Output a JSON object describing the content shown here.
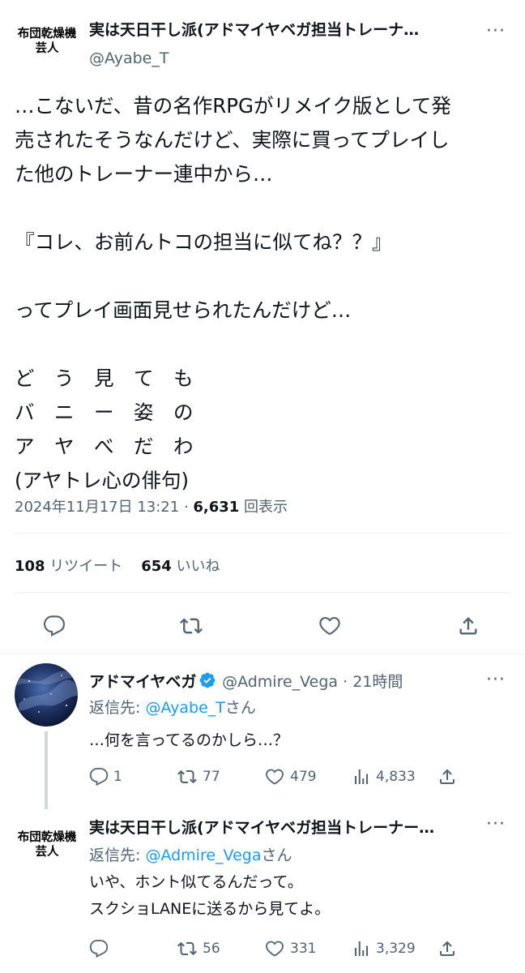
{
  "main_tweet": {
    "avatar_text_line1": "布団乾燥機",
    "avatar_text_line2": "芸人",
    "display_name": "実は天日干し派(アドマイヤベガ担当トレーナ…",
    "handle": "@Ayabe_T",
    "more_label": "···",
    "body_lines": [
      "…こないだ、昔の名作RPGがリメイク版として発",
      "売されたそうなんだけど、実際に買ってプレイし",
      "た他のトレーナー連中から…",
      "",
      "『コレ、お前んトコの担当に似てね？？』",
      "",
      "ってプレイ画面見せられたんだけど…",
      "",
      "ど　う　見　て　も",
      "バ　ニ　ー　姿　の",
      "ア　ヤ　べ　だ　わ",
      "(アヤトレ心の俳句)"
    ],
    "timestamp": "2024年11月17日 13:21",
    "separator": " · ",
    "views_count": "6,631",
    "views_label": " 回表示",
    "retweets_count": "108",
    "retweets_label": " リツイート",
    "likes_count": "654",
    "likes_label": " いいね",
    "actions": [
      "reply-icon",
      "retweet-icon",
      "like-icon",
      "share-icon"
    ]
  },
  "replies": [
    {
      "display_name": "アドマイヤベガ",
      "handle_time": "@Admire_Vega · 21時間",
      "more_label": "···",
      "reply_to_prefix": "返信先: ",
      "reply_to_mention": "@Ayabe_T",
      "reply_to_suffix": "さん",
      "text_lines": [
        "…何を言ってるのかしら…？"
      ],
      "reply_count": "1",
      "retweet_count": "77",
      "like_count": "479",
      "views_count": "4,833",
      "verified": true,
      "avatar_colors": [
        "#0b1a3a",
        "#3f5f9a"
      ]
    },
    {
      "avatar_text_line1": "布団乾燥機",
      "avatar_text_line2": "芸人",
      "display_name": "実は天日干し派(アドマイヤベガ担当トレーナー…",
      "more_label": "···",
      "reply_to_prefix": "返信先: ",
      "reply_to_mention": "@Admire_Vega",
      "reply_to_suffix": "さん",
      "text_lines": [
        "いや、ホント似てるんだって。",
        "スクショLANEに送るから見てよ。"
      ],
      "reply_count": "",
      "retweet_count": "56",
      "like_count": "331",
      "views_count": "3,329"
    }
  ],
  "colors": {
    "text": "#0f1419",
    "secondary": "#536471",
    "link": "#1d9bf0",
    "divider": "#eff3f4"
  }
}
